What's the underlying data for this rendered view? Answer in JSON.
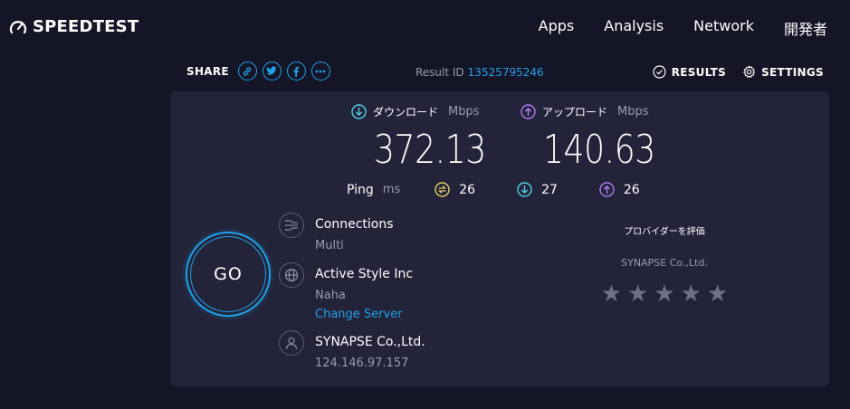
{
  "brand": {
    "logo_text": "SPEEDTEST"
  },
  "nav": {
    "items": [
      "Apps",
      "Analysis",
      "Network",
      "開発者"
    ]
  },
  "share": {
    "label": "SHARE"
  },
  "result": {
    "label": "Result ID",
    "id": "13525795246"
  },
  "actions": {
    "results_label": "RESULTS",
    "settings_label": "SETTINGS"
  },
  "download": {
    "label": "ダウンロード",
    "unit": "Mbps",
    "value": "372.13"
  },
  "upload": {
    "label": "アップロード",
    "unit": "Mbps",
    "value": "140.63"
  },
  "ping": {
    "label": "Ping",
    "unit": "ms",
    "idle": "26",
    "download": "27",
    "upload": "26"
  },
  "go_button": {
    "label": "GO"
  },
  "connections": {
    "title": "Connections",
    "value": "Multi"
  },
  "server": {
    "name": "Active Style Inc",
    "location": "Naha",
    "change_label": "Change Server"
  },
  "isp": {
    "name": "SYNAPSE Co.,Ltd.",
    "ip": "124.146.97.157"
  },
  "rating": {
    "title": "プロバイダーを評価",
    "provider": "SYNAPSE Co.,Ltd.",
    "stars": [
      "★",
      "★",
      "★",
      "★",
      "★"
    ]
  },
  "colors": {
    "background": "#141526",
    "panel": "#23243a",
    "accent": "#1fa2e8",
    "download_accent": "#4fd2e0",
    "upload_accent": "#b17cf0",
    "ping_idle": "#e6d06a",
    "muted": "#9a9bb0"
  }
}
